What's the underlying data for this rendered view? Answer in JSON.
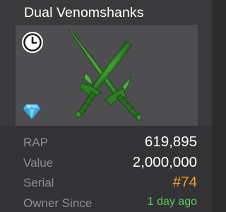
{
  "item": {
    "name": "Dual Venomshanks",
    "image_icon": "crossed-swords-icon",
    "badges": {
      "clock": "clock-icon",
      "diamond": "diamond-icon"
    }
  },
  "stats": {
    "rap_label": "RAP",
    "rap_value": "619,895",
    "value_label": "Value",
    "value_value": "2,000,000",
    "serial_label": "Serial",
    "serial_value": "#74",
    "owner_label": "Owner Since",
    "owner_value": "1 day ago"
  },
  "colors": {
    "background": "#3a3a3c",
    "image_panel": "#4e4e50",
    "label_gray": "#8e8e92",
    "serial_orange": "#f29a2e",
    "owner_green": "#5dc95a",
    "sword_green": "#3e9a34"
  }
}
